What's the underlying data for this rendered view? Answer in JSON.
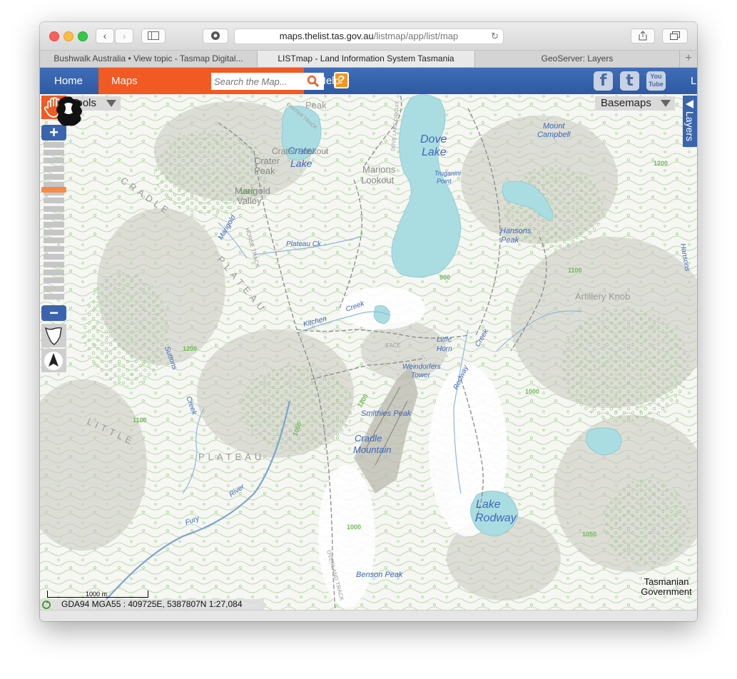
{
  "browser": {
    "url_host": "maps.thelist.tas.gov.au",
    "url_path": "/listmap/app/list/map",
    "tabs": [
      {
        "label": "Bushwalk Australia • View topic - Tasmap Digital...",
        "active": false
      },
      {
        "label": "LISTmap - Land Information System Tasmania",
        "active": true
      },
      {
        "label": "GeoServer: Layers",
        "active": false
      }
    ]
  },
  "nav": {
    "home": "Home",
    "maps": "Maps",
    "search_placeholder": "Search the Map...",
    "help_q": "?",
    "help": "Help",
    "facebook": "f",
    "twitter": "t",
    "youtube": "You Tube",
    "right_label": "L"
  },
  "map": {
    "tools_label": "Tools",
    "basemaps_label": "Basemaps",
    "layers_label": "Layers",
    "zoom_level_fraction": 0.3,
    "scale_label": "1000 m",
    "coords_text": "GDA94 MGA55 : 409725E, 5387807N 1:27,084",
    "tasgov_line1": "Tasmanian",
    "tasgov_line2": "Government",
    "labels": {
      "dove_lake_1": "Dove",
      "dove_lake_2": "Lake",
      "crater_lake_1": "Crater",
      "crater_lake_2": "Lake",
      "crater_peak_1": "Crater",
      "crater_peak_2": "Peak",
      "crater_lookout": "Crater Lookout",
      "marions_lookout_1": "Marions",
      "marions_lookout_2": "Lookout",
      "marigold_valley_1": "Marigold",
      "marigold_valley_2": "Valley",
      "marigold_creek": "Marigold",
      "truganini_1": "Truganini",
      "truganini_2": "Point",
      "mount_campbell_1": "Mount",
      "mount_campbell_2": "Campbell",
      "hansons_peak_1": "Hansons",
      "hansons_peak_2": "Peak",
      "artillery_knob": "Artillery Knob",
      "cradle": "CRADLE",
      "plateau": "PLATEAU",
      "little": "LITTLE",
      "plateau2": "PLATEAU",
      "plateau_creek": "Plateau Ck",
      "kitchen_creek_1": "Kitchen",
      "kitchen_creek_2": "Creek",
      "little_horn_1": "Little",
      "little_horn_2": "Horn",
      "weindorfers_1": "Weindorfers",
      "weindorfers_2": "Tower",
      "smithies_peak": "Smithies Peak",
      "cradle_mountain_1": "Cradle",
      "cradle_mountain_2": "Mountain",
      "lake_rodway_1": "Lake",
      "lake_rodway_2": "Rodway",
      "benson_peak": "Benson Peak",
      "fury_river_1": "Fury",
      "fury_river_2": "River",
      "sutton_creek_1": "Suttons",
      "sutton_creek_2": "Creek",
      "rodway_track": "Rodway",
      "overland_track": "OVERLAND TRACK",
      "horse_track": "HORSE TRACK",
      "face_track": "FACE",
      "dove_lake_circuit": "DOVE LAKE CIRCUIT",
      "crater_lake_track": "CRATER TRACK",
      "peak": "Peak",
      "creek_right": "Creek",
      "hansons_right": "Hansons"
    }
  },
  "colors": {
    "nav_blue": "#3a64ad",
    "maps_orange": "#f15a22",
    "water": "#aadde2",
    "water_label": "#3d67b8",
    "contour_green": "#7fc46a",
    "track_gray": "#888888"
  }
}
